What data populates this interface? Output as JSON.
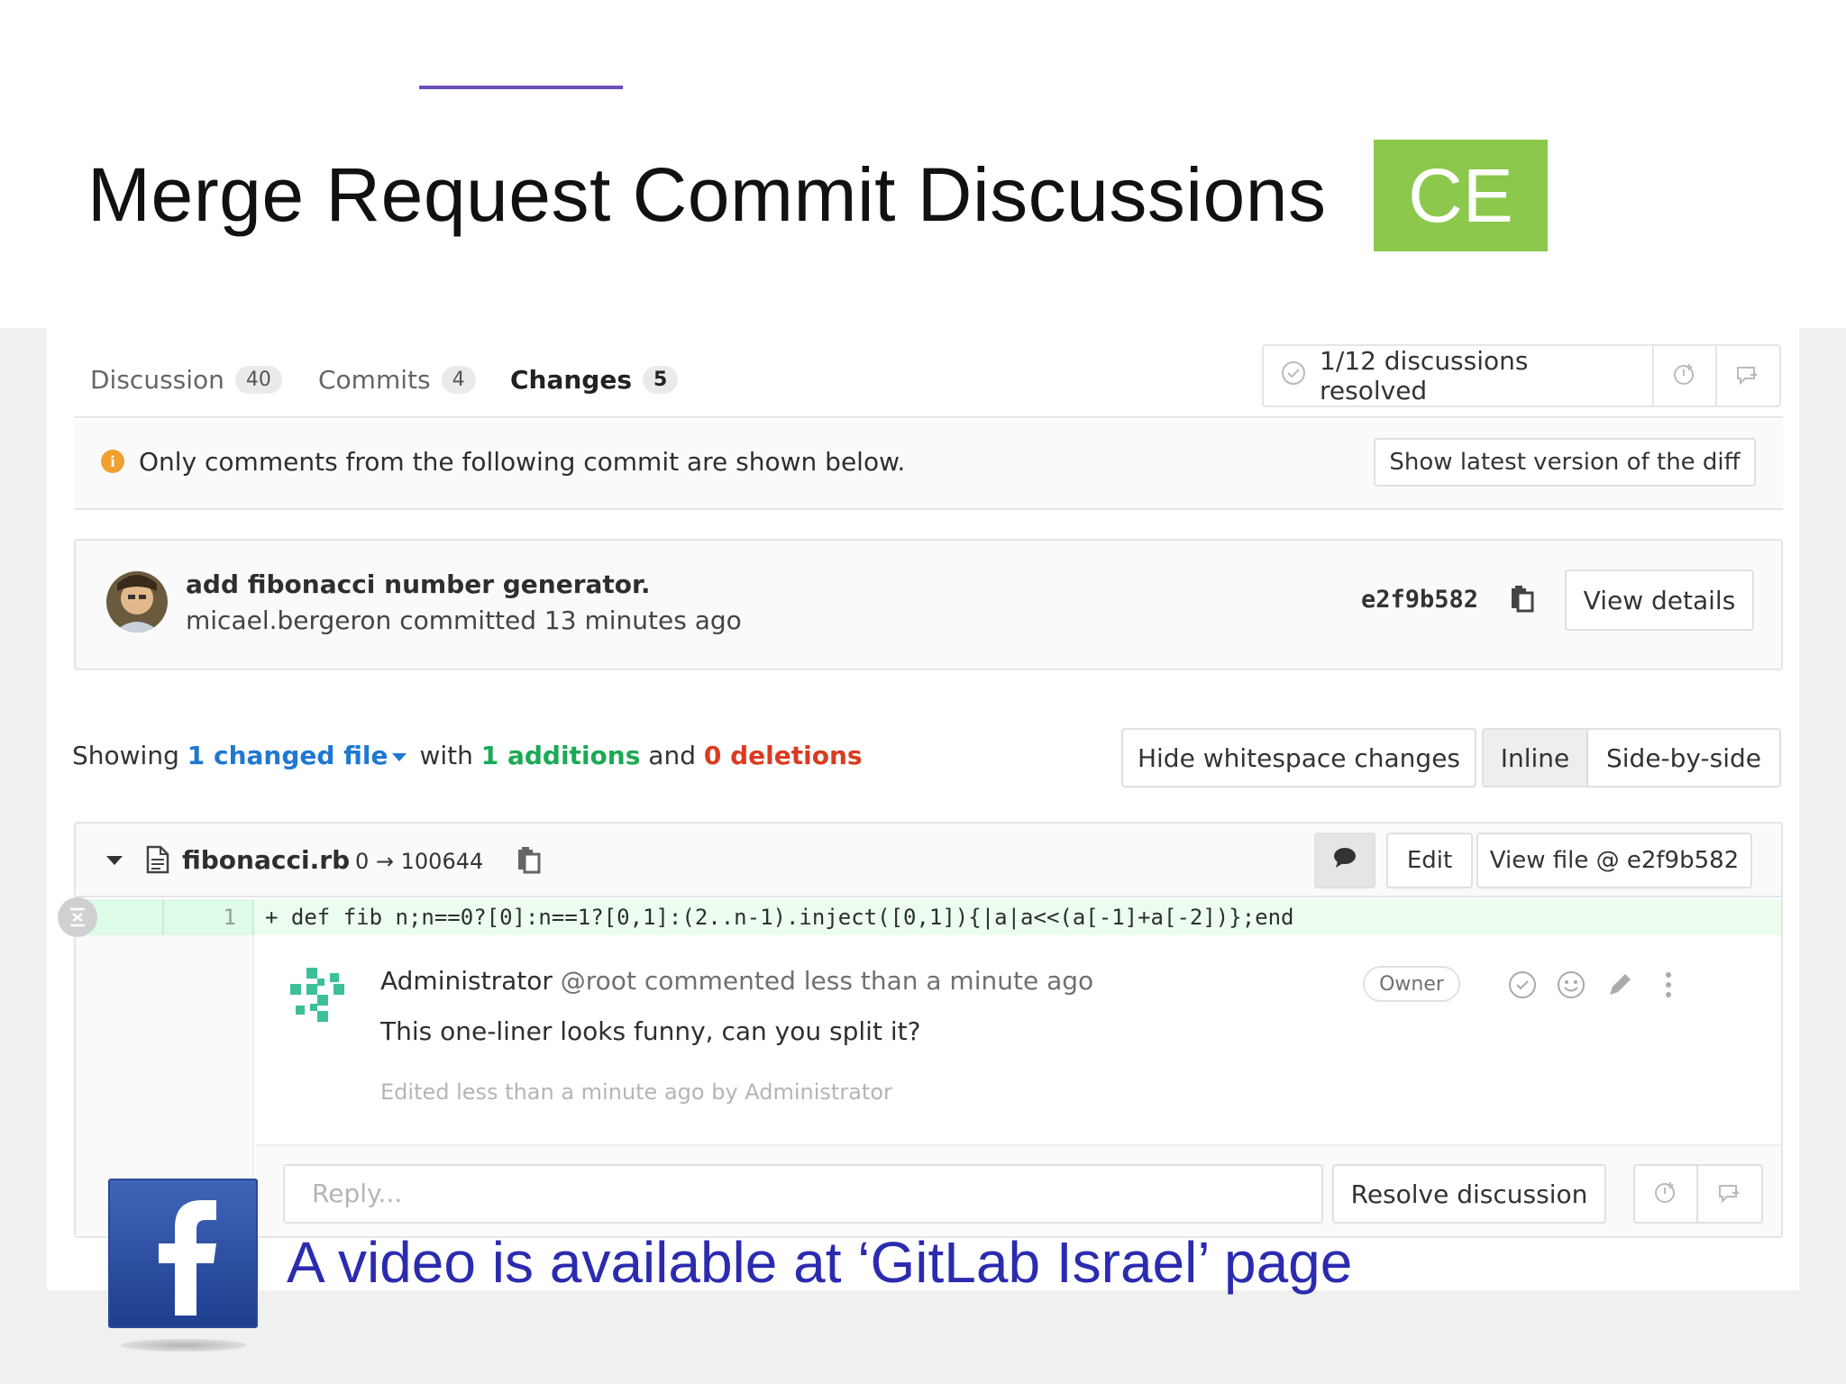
{
  "slide": {
    "title": "Merge Request Commit Discussions",
    "badge": "CE",
    "badge_color": "#8cc84b",
    "caption": "A video is available at ‘GitLab Israel’ page",
    "caption_color": "#2b2bb0",
    "social_icon": "facebook-logo"
  },
  "tabs": [
    {
      "label": "Discussion",
      "count": "40",
      "active": false
    },
    {
      "label": "Commits",
      "count": "4",
      "active": false
    },
    {
      "label": "Changes",
      "count": "5",
      "active": true
    }
  ],
  "discussions": {
    "resolved_text": "1/12 discussions resolved",
    "icons": [
      "check-circle-icon",
      "jump-to-next-discussion-icon",
      "comment-bubble-icon"
    ]
  },
  "info_bar": {
    "icon": "info-icon",
    "message": "Only comments from the following commit are shown below.",
    "button": "Show latest version of the diff"
  },
  "commit": {
    "title": "add fibonacci number generator.",
    "meta": "micael.bergeron committed 13 minutes ago",
    "sha": "e2f9b582",
    "view_details": "View details"
  },
  "summary": {
    "showing": "Showing",
    "changed_files": "1 changed file",
    "with": "with",
    "additions": "1 additions",
    "and": "and",
    "deletions": "0 deletions",
    "hide_whitespace": "Hide whitespace changes",
    "inline": "Inline",
    "side_by_side": "Side-by-side"
  },
  "file": {
    "name": "fibonacci.rb",
    "mode": "0 → 100644",
    "edit": "Edit",
    "view_file": "View file @ e2f9b582",
    "line_number": "1",
    "code_line": "+ def fib n;n==0?[0]:n==1?[0,1]:(2..n-1).inject([0,1]){|a|a<<(a[-1]+a[-2])};end"
  },
  "note": {
    "author": "Administrator",
    "handle": "@root",
    "action": "commented less than a minute ago",
    "role": "Owner",
    "body": "This one-liner looks funny, can you split it?",
    "edited": "Edited less than a minute ago by Administrator"
  },
  "reply": {
    "placeholder": "Reply...",
    "resolve": "Resolve discussion"
  }
}
